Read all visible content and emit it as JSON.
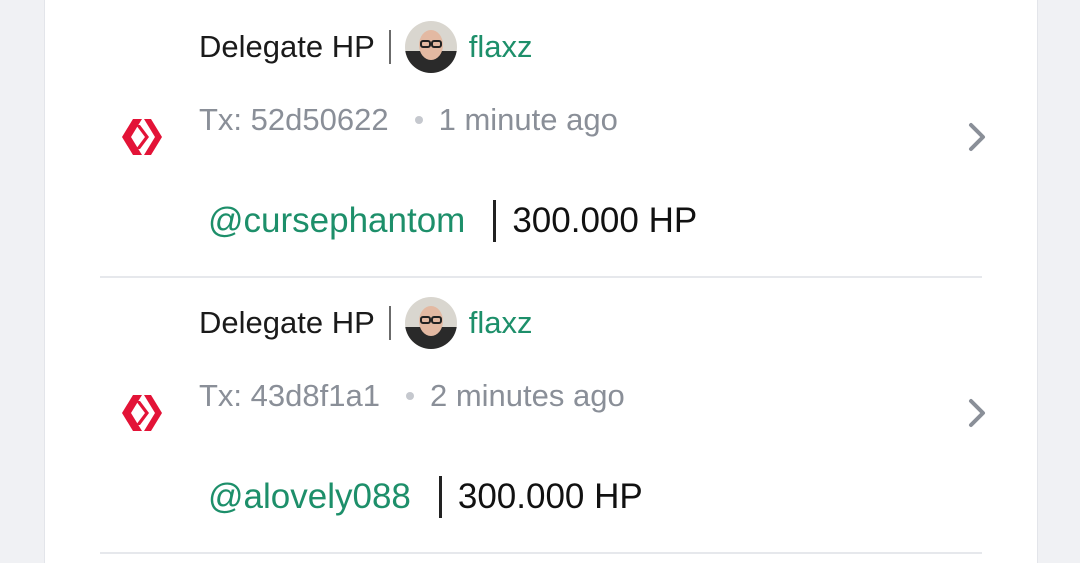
{
  "transactions": [
    {
      "operation": "Delegate HP",
      "author": "flaxz",
      "tx": "Tx: 52d50622",
      "time": "1 minute ago",
      "target": "@cursephantom",
      "amount": "300.000 HP"
    },
    {
      "operation": "Delegate HP",
      "author": "flaxz",
      "tx": "Tx: 43d8f1a1",
      "time": "2 minutes ago",
      "target": "@alovely088",
      "amount": "300.000 HP"
    }
  ],
  "icons": {
    "chain": "hive-logo-icon",
    "open": "chevron-right-icon"
  },
  "colors": {
    "accent": "#1d8f6a",
    "hive": "#e31337",
    "muted": "#8a8f98"
  }
}
